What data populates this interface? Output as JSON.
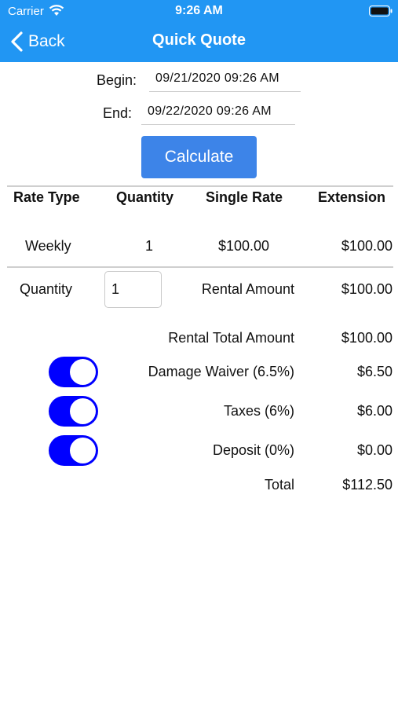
{
  "status_bar": {
    "carrier": "Carrier",
    "time": "9:26 AM"
  },
  "nav": {
    "back_label": "Back",
    "title": "Quick Quote"
  },
  "dates": {
    "begin_label": "Begin:",
    "begin_value": "09/21/2020 09:26 AM",
    "end_label": "End:",
    "end_value": "09/22/2020 09:26 AM"
  },
  "calculate_label": "Calculate",
  "rate_table": {
    "headers": [
      "Rate Type",
      "Quantity",
      "Single Rate",
      "Extension"
    ],
    "rows": [
      {
        "rate_type": "Weekly",
        "quantity": "1",
        "single_rate": "$100.00",
        "extension": "$100.00"
      }
    ]
  },
  "quantity": {
    "label": "Quantity",
    "value": "1"
  },
  "rental_amount": {
    "label": "Rental Amount",
    "value": "$100.00"
  },
  "rental_total": {
    "label": "Rental Total Amount",
    "value": "$100.00"
  },
  "options": [
    {
      "label": "Damage Waiver (6.5%)",
      "value": "$6.50",
      "enabled": true
    },
    {
      "label": "Taxes (6%)",
      "value": "$6.00",
      "enabled": true
    },
    {
      "label": "Deposit (0%)",
      "value": "$0.00",
      "enabled": true
    }
  ],
  "total": {
    "label": "Total",
    "value": "$112.50"
  },
  "colors": {
    "header": "#2196F3",
    "button": "#3d84e8",
    "toggle_on": "#0000ff"
  }
}
